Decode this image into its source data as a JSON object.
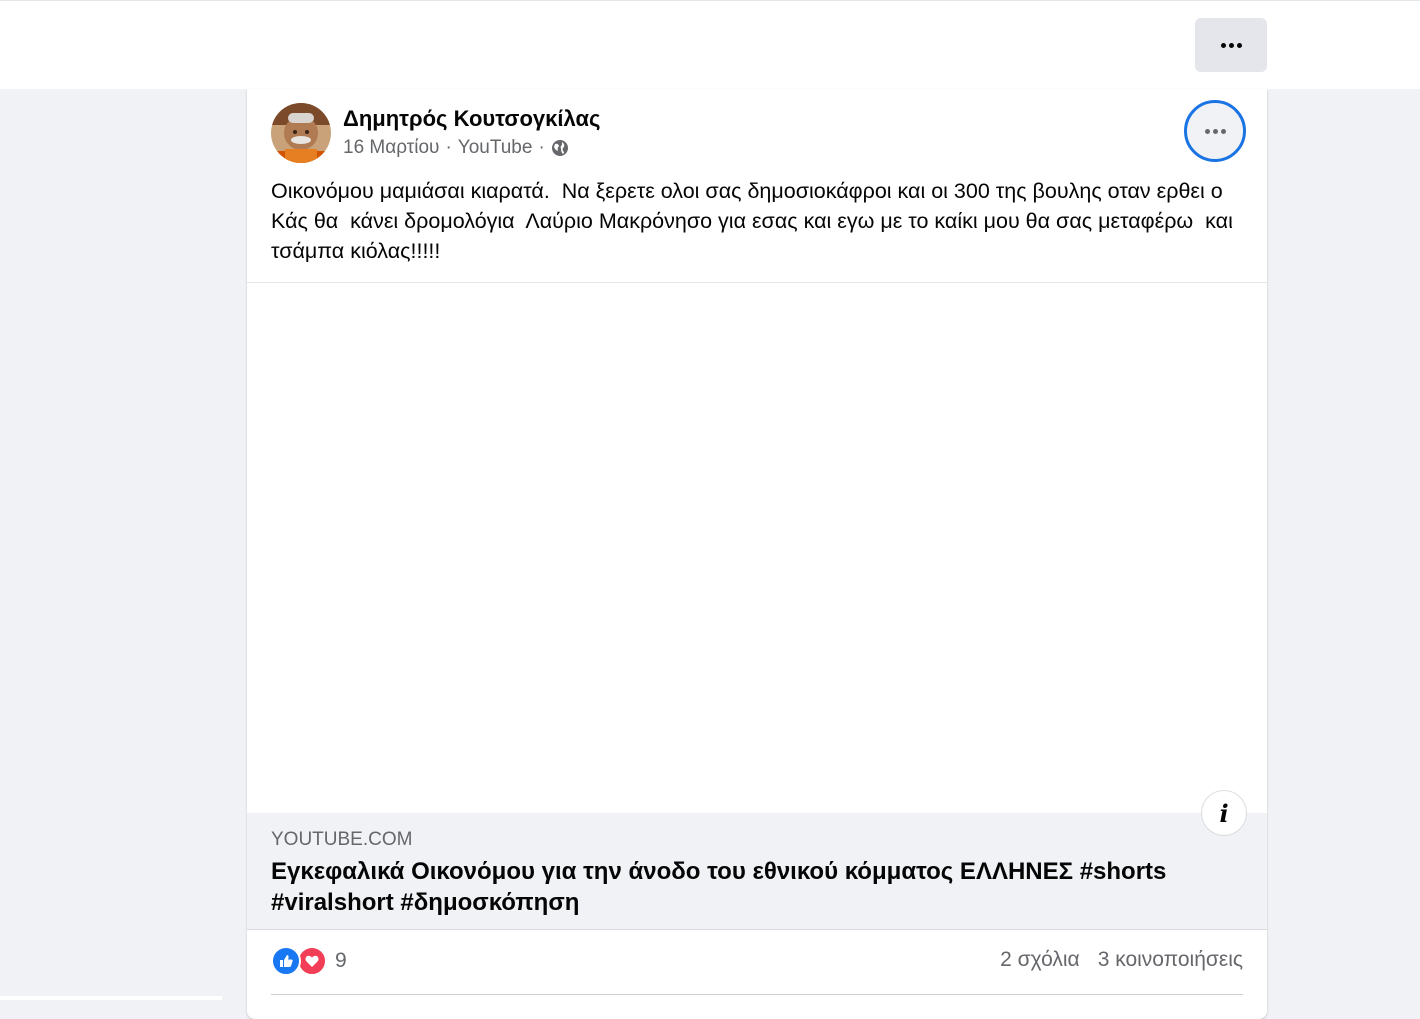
{
  "topbar": {
    "more_icon": "more-horizontal-icon"
  },
  "post": {
    "author": "Δημητρός Κουτσογκίλας",
    "date": "16 Μαρτίου",
    "source": "YouTube",
    "separator": "·",
    "privacy_icon": "globe-icon",
    "more_icon": "more-horizontal-icon",
    "text": "Οικονόμου μαμιάσαι κιαρατά.  Να ξερετε ολοι σας δημοσιοκάφροι και οι 300 της βουλης οταν ερθει ο Κάς θα  κάνει δρομολόγια  Λαύριο Μακρόνησο για εσας και εγω με το καίκι μου θα σας μεταφέρω  και τσάμπα κιόλας!!!!!"
  },
  "link": {
    "domain": "YOUTUBE.COM",
    "title": "Εγκεφαλικά Οικονόμου για την άνοδο του εθνικού κόμματος ΕΛΛΗΝΕΣ #shorts #viralshort #δημοσκόπηση",
    "info_icon": "info-icon"
  },
  "stats": {
    "reaction_icons": [
      "like-icon",
      "love-icon"
    ],
    "reaction_count": "9",
    "comments": "2 σχόλια",
    "shares": "3 κοινοποιήσεις"
  },
  "colors": {
    "accent": "#1b74e4",
    "like": "#1877f2",
    "love": "#f33e58",
    "secondary_text": "#65676b",
    "page_bg": "#f0f2f5"
  }
}
